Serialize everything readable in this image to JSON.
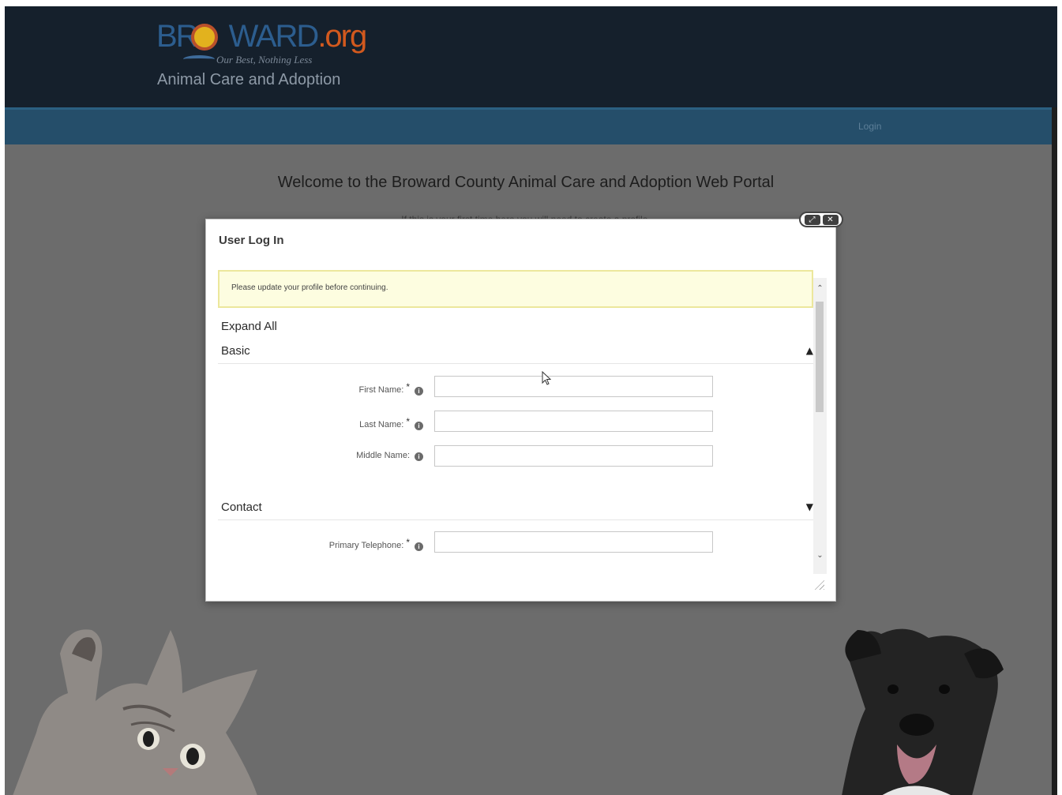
{
  "header": {
    "logo_main_prefix": "BR",
    "logo_main_suffix": "WARD",
    "logo_org": ".org",
    "logo_tagline": "Our Best, Nothing Less",
    "subtitle": "Animal Care and Adoption"
  },
  "nav": {
    "login_label": "Login"
  },
  "main": {
    "welcome": "Welcome to the Broward County Animal Care and Adoption Web Portal",
    "first_time_note": "If this is your first time here you will need to create a profile."
  },
  "modal": {
    "title": "User Log In",
    "alert": "Please update your profile before continuing.",
    "expand_all": "Expand All",
    "sections": [
      {
        "label": "Basic",
        "expanded": true,
        "fields": [
          {
            "label": "First Name:",
            "required": true,
            "value": ""
          },
          {
            "label": "Last Name:",
            "required": true,
            "value": ""
          },
          {
            "label": "Middle Name:",
            "required": false,
            "value": ""
          }
        ]
      },
      {
        "label": "Contact",
        "expanded": false,
        "fields": [
          {
            "label": "Primary Telephone:",
            "required": true,
            "value": ""
          }
        ]
      }
    ],
    "required_mark": "*",
    "info_glyph": "i"
  },
  "icons": {
    "maximize": "⤢",
    "close": "✕",
    "chevron_up": "▲",
    "chevron_down": "▼",
    "caret_up": "⌃",
    "caret_down": "⌄"
  },
  "colors": {
    "header_bg": "#15202c",
    "nav_bg": "#254e6a",
    "overlay": "#6c6c6c",
    "alert_bg": "#fdfde0",
    "alert_border": "#ece79c"
  }
}
